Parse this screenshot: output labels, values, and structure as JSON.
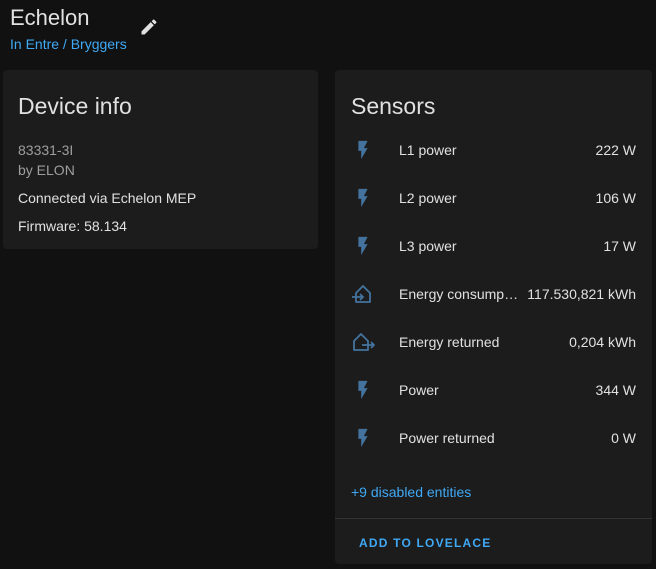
{
  "header": {
    "title": "Echelon",
    "breadcrumb": "In Entre / Bryggers"
  },
  "device_info": {
    "title": "Device info",
    "model": "83331-3I",
    "manufacturer": "by ELON",
    "connected": "Connected via Echelon MEP",
    "firmware": "Firmware: 58.134"
  },
  "sensors": {
    "title": "Sensors",
    "items": [
      {
        "name": "L1 power",
        "value": "222 W",
        "icon": "flash-icon"
      },
      {
        "name": "L2 power",
        "value": "106 W",
        "icon": "flash-icon"
      },
      {
        "name": "L3 power",
        "value": "17 W",
        "icon": "flash-icon"
      },
      {
        "name": "Energy consumption",
        "value": "117.530,821 kWh",
        "icon": "home-import-icon"
      },
      {
        "name": "Energy returned",
        "value": "0,204 kWh",
        "icon": "home-export-icon"
      },
      {
        "name": "Power",
        "value": "344 W",
        "icon": "flash-icon"
      },
      {
        "name": "Power returned",
        "value": "0 W",
        "icon": "flash-icon"
      }
    ],
    "disabled_link": "+9 disabled entities",
    "add_lovelace": "ADD TO LOVELACE"
  },
  "colors": {
    "accent": "#3fa9f5",
    "icon": "#44739e",
    "background": "#111111",
    "card": "#1c1c1c"
  }
}
